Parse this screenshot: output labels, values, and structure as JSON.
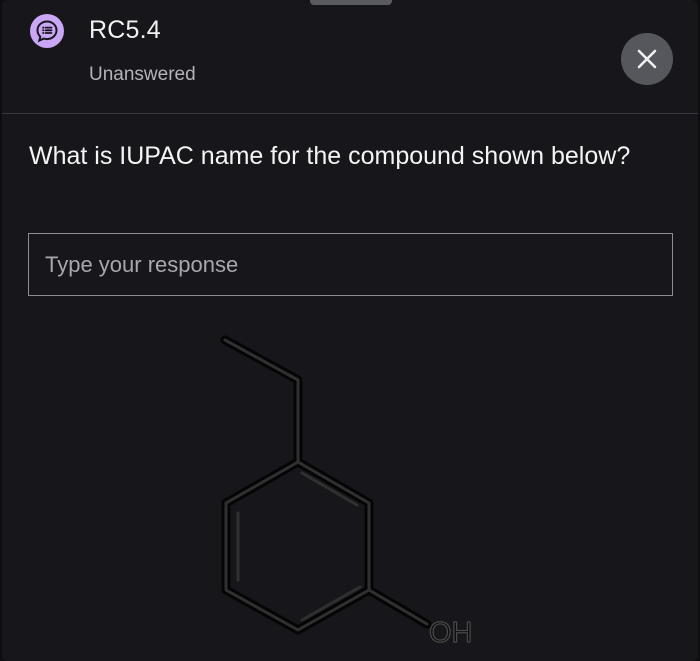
{
  "header": {
    "title": "RC5.4",
    "status": "Unanswered",
    "badge_icon": "chat-list-icon",
    "close_icon": "close-icon",
    "accent_color": "#c9a7f5"
  },
  "question": {
    "text": "What is IUPAC name for the compound shown below?"
  },
  "response": {
    "value": "",
    "placeholder": "Type your response"
  },
  "structure": {
    "description_icon": "skeletal-structure",
    "hydroxyl_label": "OH"
  }
}
